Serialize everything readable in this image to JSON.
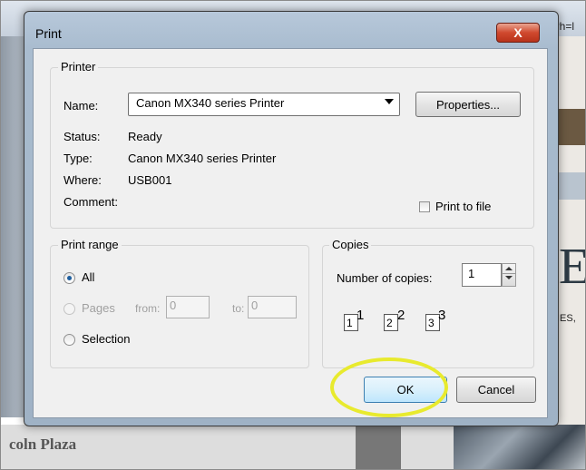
{
  "background": {
    "url_fragment": "?h=l",
    "side_text": "IES,",
    "big_letter": "E(",
    "bottom_text": "coln Plaza"
  },
  "dialog": {
    "title": "Print",
    "close_label": "X",
    "printer": {
      "legend": "Printer",
      "name_label": "Name:",
      "name_value": "Canon MX340 series Printer",
      "properties_label": "Properties...",
      "status_label": "Status:",
      "status_value": "Ready",
      "type_label": "Type:",
      "type_value": "Canon MX340 series Printer",
      "where_label": "Where:",
      "where_value": "USB001",
      "comment_label": "Comment:",
      "print_to_file_label": "Print to file"
    },
    "print_range": {
      "legend": "Print range",
      "all_label": "All",
      "pages_label": "Pages",
      "from_label": "from:",
      "from_value": "0",
      "to_label": "to:",
      "to_value": "0",
      "selection_label": "Selection",
      "selected": "All"
    },
    "copies": {
      "legend": "Copies",
      "number_label": "Number of copies:",
      "number_value": "1",
      "collate_pages": [
        "1",
        "2",
        "3"
      ]
    },
    "ok_label": "OK",
    "cancel_label": "Cancel"
  },
  "colors": {
    "highlight": "#e8ea2e",
    "close_button": "#d0492e"
  }
}
